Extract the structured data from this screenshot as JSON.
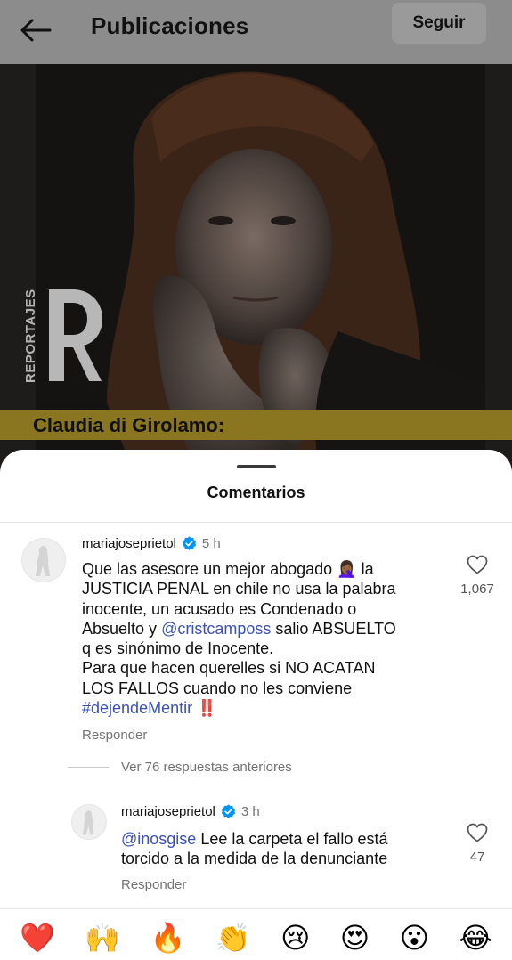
{
  "header": {
    "title": "Publicaciones",
    "follow_label": "Seguir"
  },
  "post": {
    "brand_text": "REPORTAJES",
    "caption": "Claudia di Girolamo:"
  },
  "comments_sheet": {
    "title": "Comentarios",
    "comments": [
      {
        "username": "mariajoseprietol",
        "time": "5 h",
        "text_1": "Que las asesore un mejor abogado 🤦🏾‍♀️ la",
        "text_2": "JUSTICIA PENAL en chile no usa la palabra",
        "text_3": "inocente,  un acusado es Condenado o",
        "text_4a": "Absuelto y ",
        "mention": "@cristcamposs",
        "text_4b": " salio ABSUELTO",
        "text_5": "q es sinónimo de Inocente.",
        "text_6": "Para que hacen querelles si NO ACATAN",
        "text_7": "LOS FALLOS cuando no les conviene",
        "hashtag": "#dejendeMentir",
        "hashtag_suffix": " ‼️",
        "likes": "1,067",
        "reply_label": "Responder"
      },
      {
        "username": "mariajoseprietol",
        "time": "3 h",
        "mention": "@inosgise",
        "text_1": " Lee la carpeta el fallo está",
        "text_2": "torcido a la medida de la denunciante",
        "likes": "47",
        "reply_label": "Responder"
      }
    ],
    "view_replies_label": "Ver 76 respuestas anteriores"
  },
  "emoji_bar": [
    "❤️",
    "🙌",
    "🔥",
    "👏",
    "😢",
    "😍",
    "😮",
    "😂"
  ],
  "colors": {
    "mention": "#3b51b5",
    "verified": "#0095f6",
    "caption_strip": "#8a7620"
  }
}
